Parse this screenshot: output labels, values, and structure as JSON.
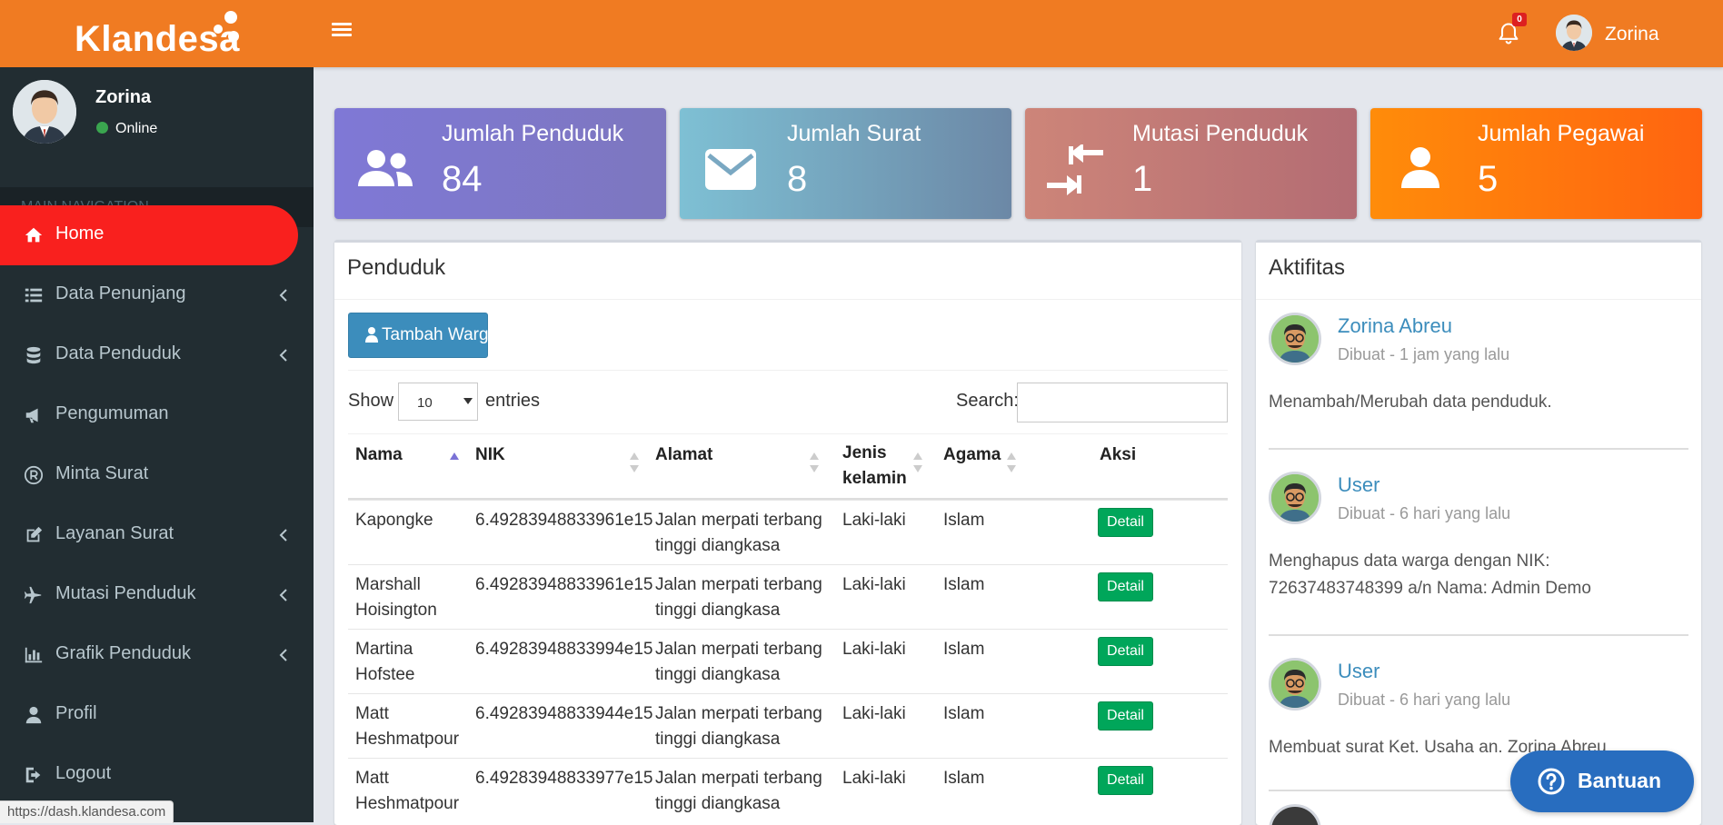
{
  "header": {
    "app_name": "Klandesa",
    "notif_count": "0",
    "user_name": "Zorina"
  },
  "sidebar": {
    "user_name": "Zorina",
    "status": "Online",
    "nav_header": "MAIN NAVIGATION",
    "items": [
      {
        "label": "Home",
        "icon": "home-icon",
        "active": true
      },
      {
        "label": "Data Penunjang",
        "icon": "list-icon",
        "has_sub": true
      },
      {
        "label": "Data Penduduk",
        "icon": "database-icon",
        "has_sub": true
      },
      {
        "label": "Pengumuman",
        "icon": "bullhorn-icon"
      },
      {
        "label": "Minta Surat",
        "icon": "registered-icon"
      },
      {
        "label": "Layanan Surat",
        "icon": "edit-icon",
        "has_sub": true
      },
      {
        "label": "Mutasi Penduduk",
        "icon": "plane-icon",
        "has_sub": true
      },
      {
        "label": "Grafik Penduduk",
        "icon": "bar-chart-icon",
        "has_sub": true
      },
      {
        "label": "Profil",
        "icon": "user-icon"
      },
      {
        "label": "Logout",
        "icon": "sign-out-icon"
      }
    ],
    "status_url": "https://dash.klandesa.com"
  },
  "stats": [
    {
      "title": "Jumlah Penduduk",
      "value": "84",
      "icon": "users-icon"
    },
    {
      "title": "Jumlah Surat",
      "value": "8",
      "icon": "envelope-icon"
    },
    {
      "title": "Mutasi Penduduk",
      "value": "1",
      "icon": "exchange-arrows-icon"
    },
    {
      "title": "Jumlah Pegawai",
      "value": "5",
      "icon": "user-icon"
    }
  ],
  "penduduk": {
    "title": "Penduduk",
    "add_button": "Tambah Warga",
    "show_label": "Show",
    "page_length": "10",
    "entries_label": "entries",
    "search_label": "Search:",
    "search_value": "",
    "columns": [
      "Nama",
      "NIK",
      "Alamat",
      "Jenis kelamin",
      "Agama",
      "Aksi"
    ],
    "jk_line1": "Jenis",
    "jk_line2": "kelamin",
    "rows": [
      {
        "nama": "Kapongke",
        "nik": "6.49283948833961e15",
        "alamat": "Jalan merpati terbang tinggi diangkasa",
        "jk": "Laki-laki",
        "agama": "Islam",
        "aksi": "Detail"
      },
      {
        "nama": "Marshall Hoisington",
        "nik": "6.49283948833961e15",
        "alamat": "Jalan merpati terbang tinggi diangkasa",
        "jk": "Laki-laki",
        "agama": "Islam",
        "aksi": "Detail"
      },
      {
        "nama": "Martina Hofstee",
        "nik": "6.49283948833994e15",
        "alamat": "Jalan merpati terbang tinggi diangkasa",
        "jk": "Laki-laki",
        "agama": "Islam",
        "aksi": "Detail"
      },
      {
        "nama": "Matt Heshmatpour",
        "nik": "6.49283948833944e15",
        "alamat": "Jalan merpati terbang tinggi diangkasa",
        "jk": "Laki-laki",
        "agama": "Islam",
        "aksi": "Detail"
      },
      {
        "nama": "Matt Heshmatpour",
        "nik": "6.49283948833977e15",
        "alamat": "Jalan merpati terbang tinggi diangkasa",
        "jk": "Laki-laki",
        "agama": "Islam",
        "aksi": "Detail"
      }
    ]
  },
  "aktifitas": {
    "title": "Aktifitas",
    "items": [
      {
        "name": "Zorina Abreu",
        "time": "Dibuat - 1 jam yang lalu",
        "desc": "Menambah/Merubah data penduduk."
      },
      {
        "name": "User",
        "time": "Dibuat - 6 hari yang lalu",
        "desc": "Menghapus data warga dengan NIK: 72637483748399 a/n Nama: Admin Demo"
      },
      {
        "name": "User",
        "time": "Dibuat - 6 hari yang lalu",
        "desc": "Membuat surat Ket. Usaha an. Zorina Abreu"
      }
    ]
  },
  "help": {
    "label": "Bantuan"
  },
  "colors": {
    "header": "#f07b22",
    "sidebar": "#222d32",
    "active": "#f9201e",
    "primary": "#3c8dbc",
    "success": "#00a65a"
  }
}
